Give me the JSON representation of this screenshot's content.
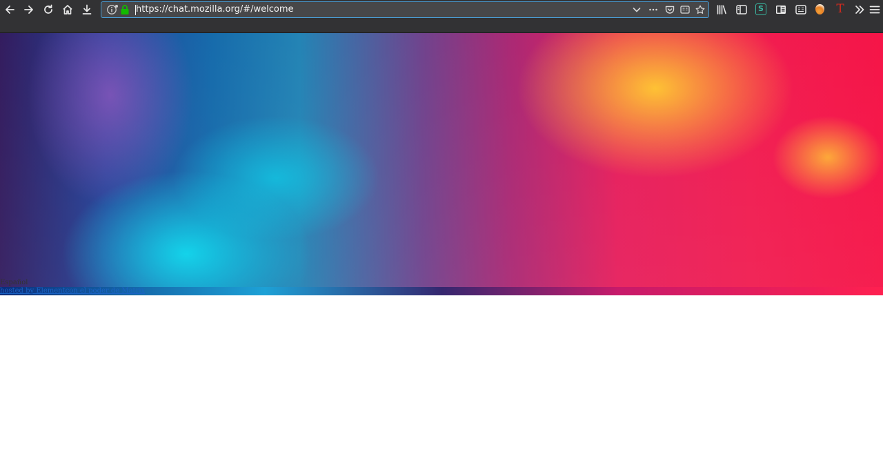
{
  "browser": {
    "url": "https://chat.mozilla.org/#/welcome",
    "nav_icons": [
      "back-icon",
      "forward-icon",
      "reload-icon",
      "home-icon",
      "download-icon"
    ],
    "url_icons": [
      "page-info-icon",
      "lock-icon",
      "dropdown-chevron-icon",
      "page-actions-icon",
      "pocket-icon",
      "reader-view-icon",
      "bookmark-star-icon"
    ],
    "toolbar_icons": [
      "library-icon",
      "sidebar-icon",
      "s-extension-icon",
      "reader-extension-icon",
      "screenshot-extension-icon",
      "ball-extension-icon",
      "t-extension-icon",
      "overflow-icon",
      "menu-icon"
    ],
    "colors": {
      "toolbar_bg": "#323234",
      "urlbar_bg": "#474749",
      "urlbar_focus_border": "#4a9ed6",
      "lock_green": "#12bc00",
      "link_blue": "#1a63c5"
    }
  },
  "page": {
    "language_label": "Español",
    "footer_link": "hosted by Elementcon el poder de Matrix"
  }
}
